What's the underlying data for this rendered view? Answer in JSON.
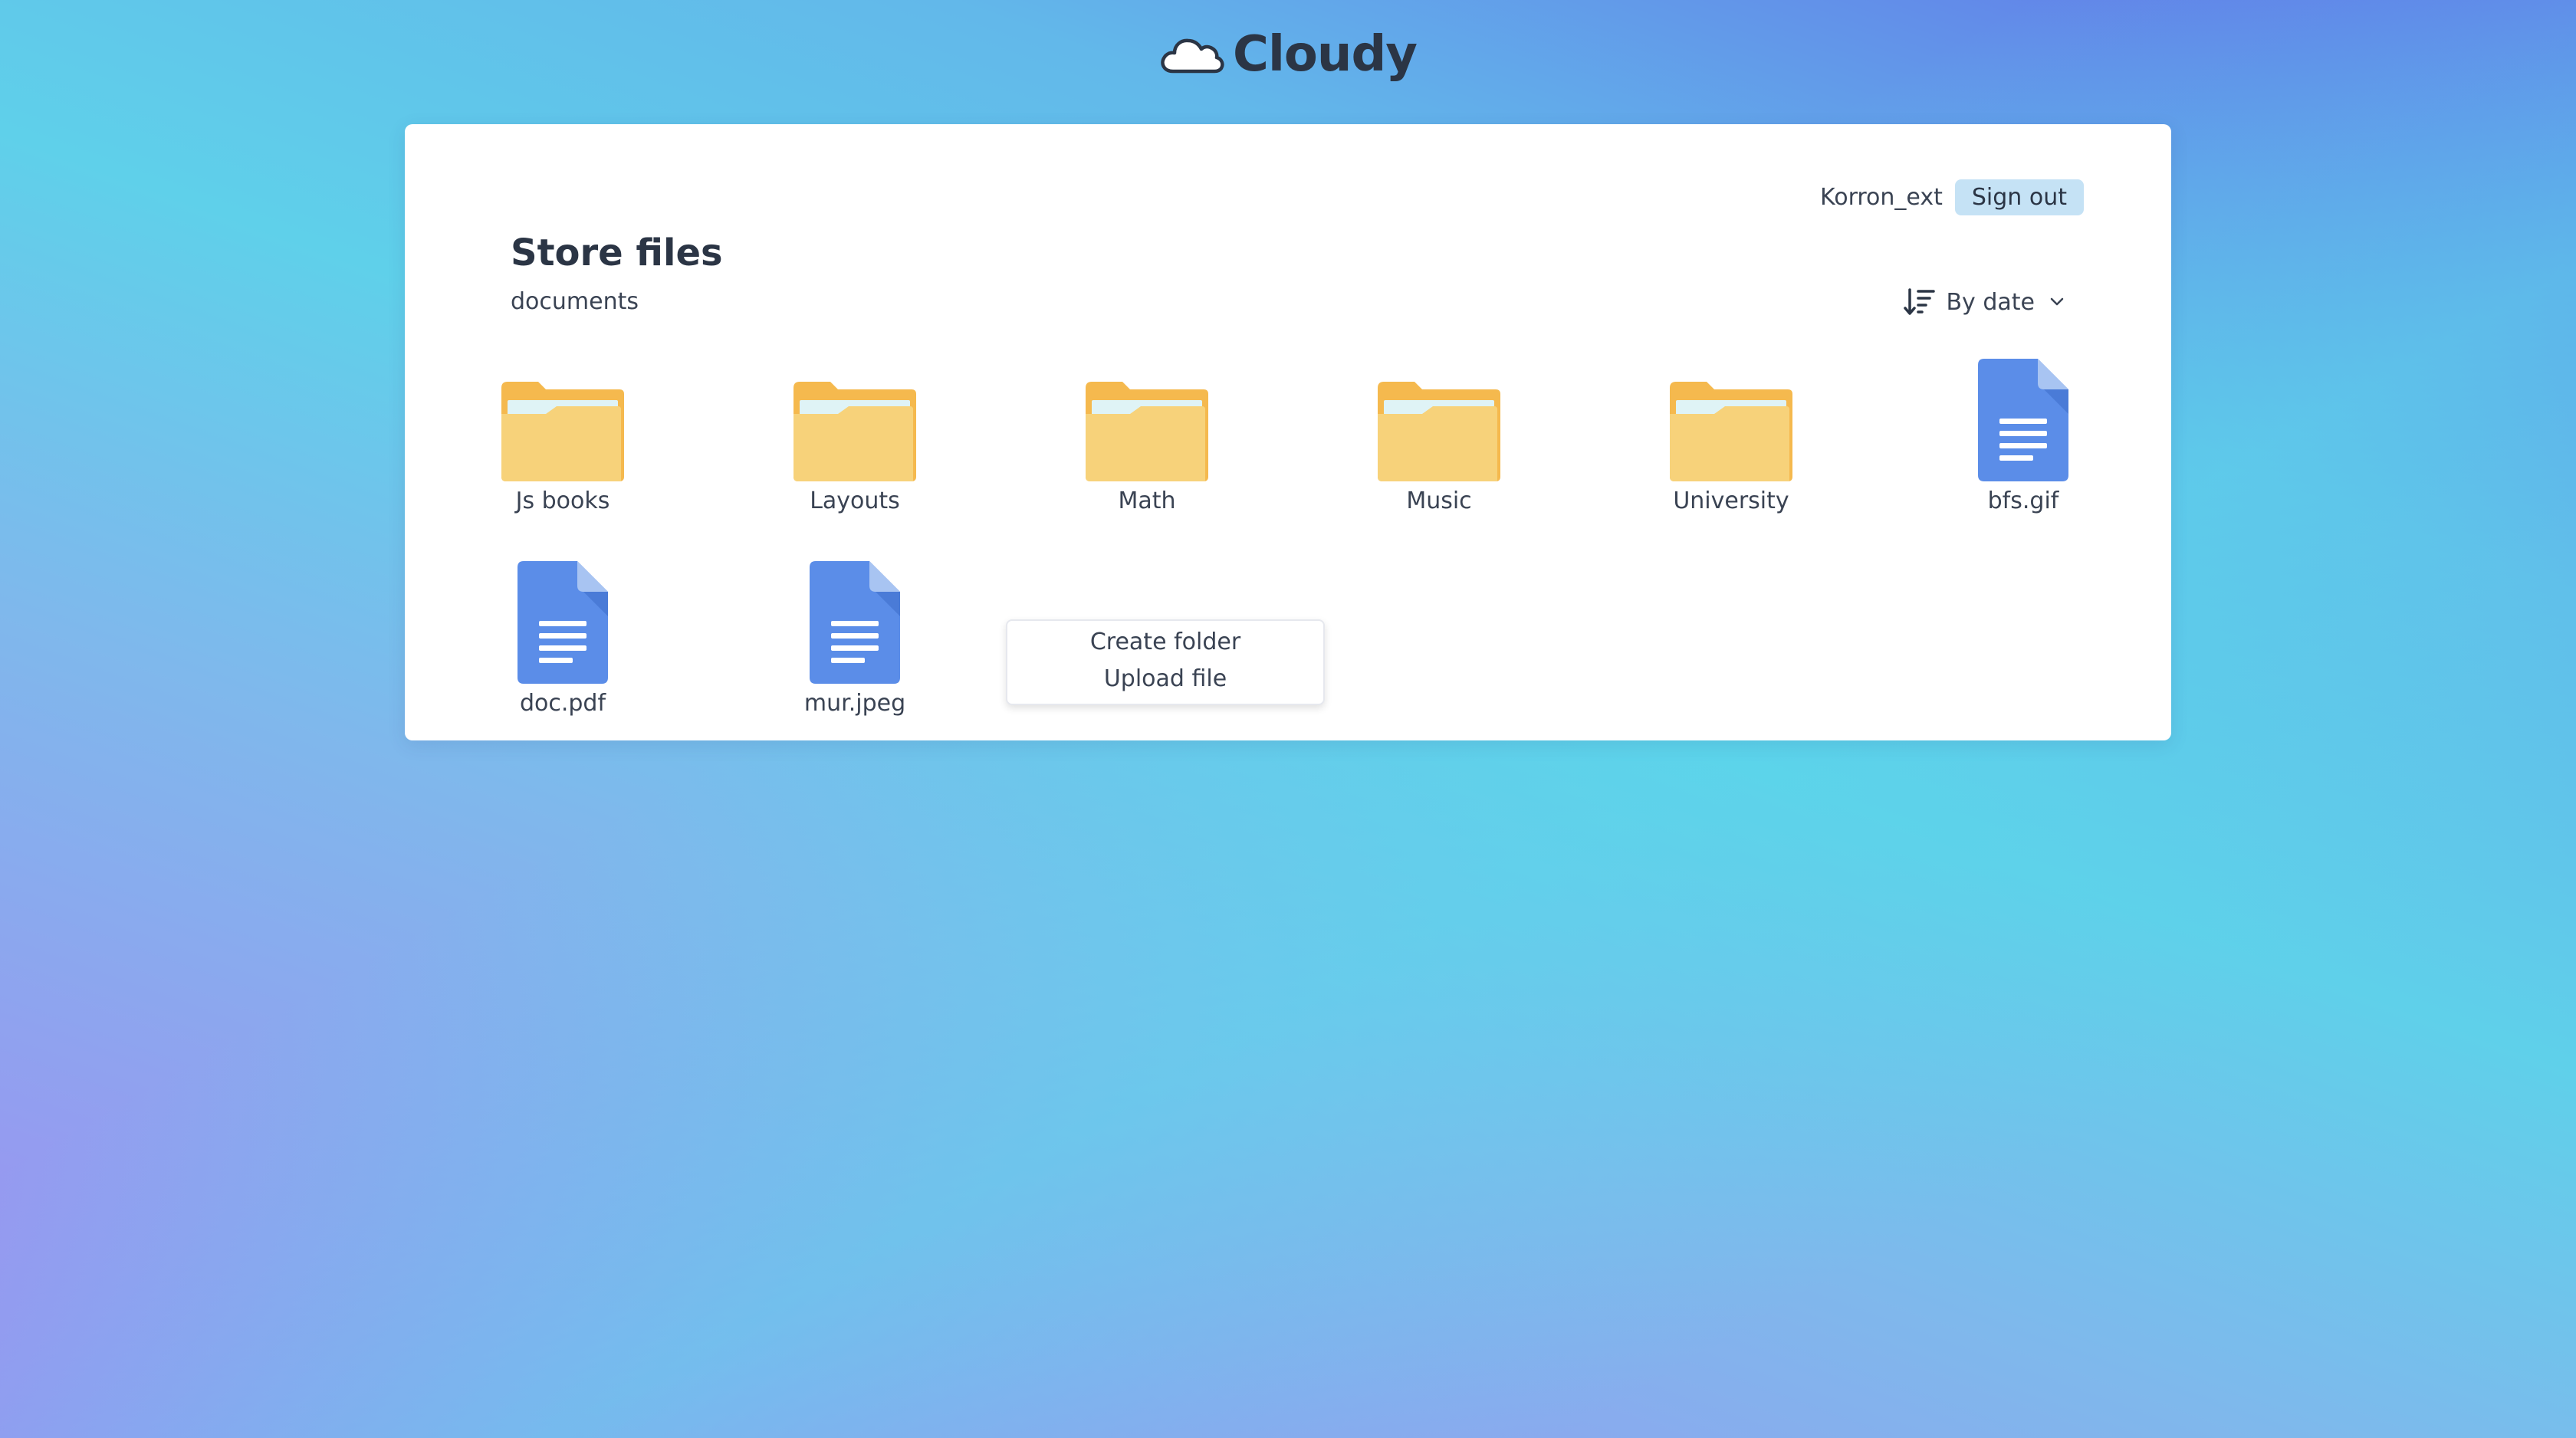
{
  "app": {
    "name": "Cloudy",
    "logo_icon": "cloud-icon"
  },
  "user": {
    "name": "Korron_ext",
    "signout_label": "Sign out"
  },
  "page": {
    "title": "Store files",
    "current_folder": "documents"
  },
  "sort": {
    "icon": "sort-descending-icon",
    "label": "By date",
    "chevron_icon": "chevron-down-icon"
  },
  "items": [
    {
      "name": "Js books",
      "type": "folder"
    },
    {
      "name": "Layouts",
      "type": "folder"
    },
    {
      "name": "Math",
      "type": "folder"
    },
    {
      "name": "Music",
      "type": "folder"
    },
    {
      "name": "University",
      "type": "folder"
    },
    {
      "name": "bfs.gif",
      "type": "file"
    },
    {
      "name": "doc.pdf",
      "type": "file"
    },
    {
      "name": "mur.jpeg",
      "type": "file"
    }
  ],
  "context_menu": {
    "items": [
      "Create folder",
      "Upload file"
    ]
  },
  "colors": {
    "folder_back": "#f5b94e",
    "folder_front": "#f7d27a",
    "folder_paper": "#dff3f6",
    "file_blue": "#5b8de8",
    "file_fold": "#a8c4f2",
    "signout_bg": "#c5e2f5",
    "text_dark": "#2b3545"
  }
}
